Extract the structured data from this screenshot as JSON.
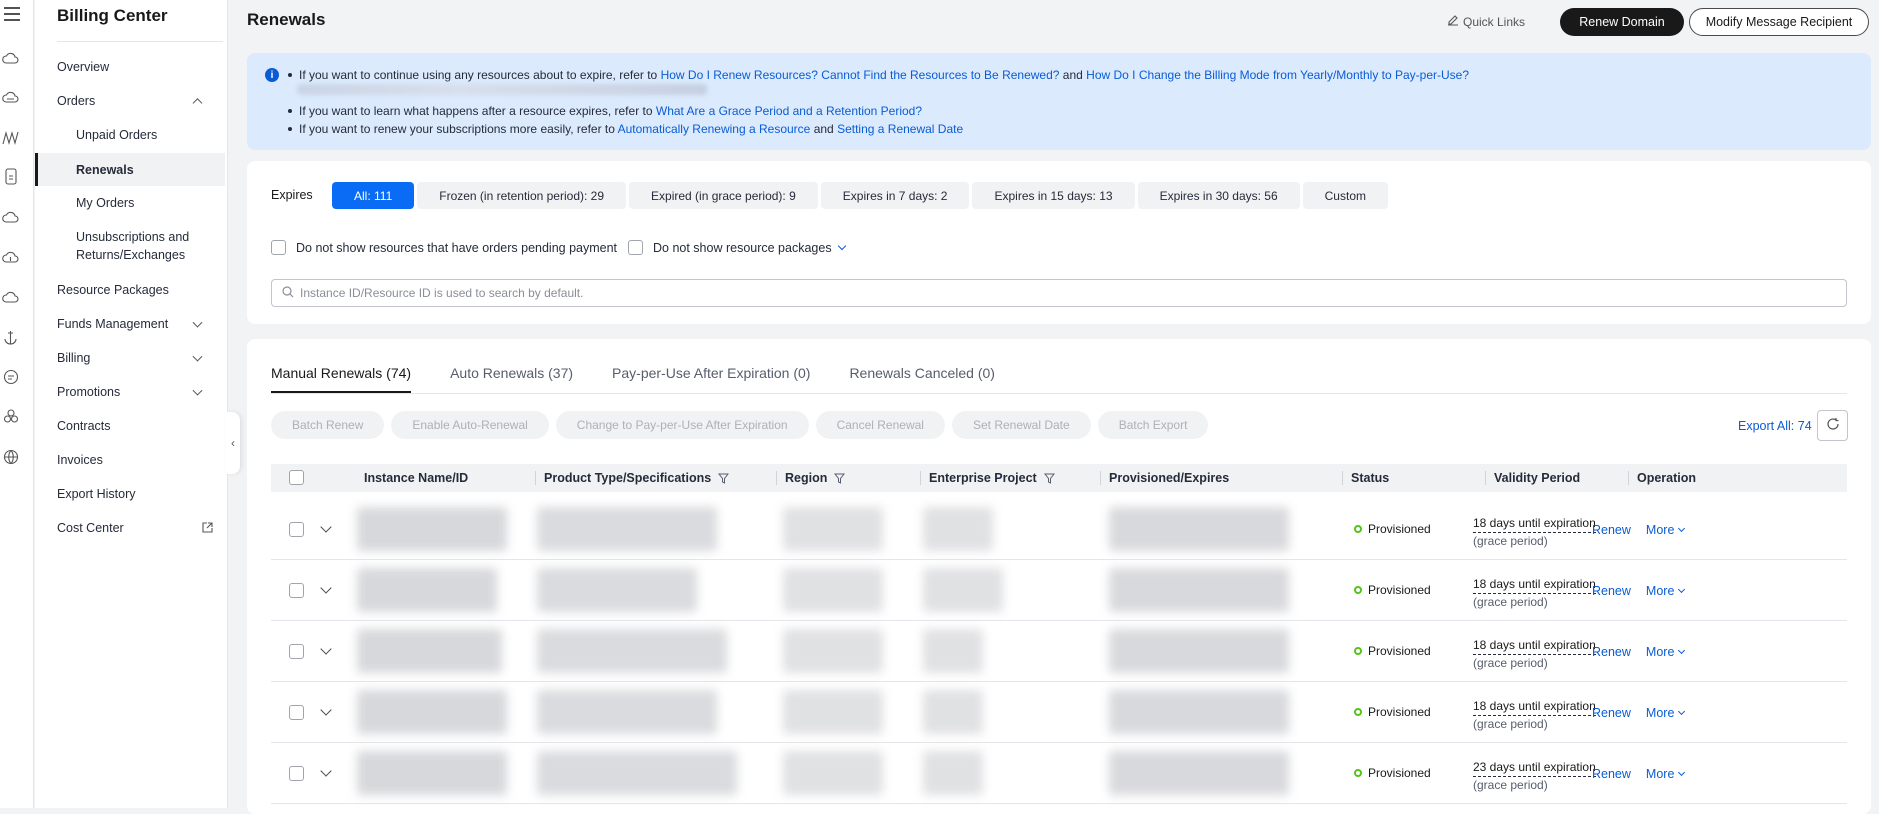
{
  "sidebar": {
    "title": "Billing Center",
    "items": [
      {
        "label": "Overview"
      },
      {
        "label": "Orders"
      },
      {
        "label": "Unpaid Orders"
      },
      {
        "label": "Renewals"
      },
      {
        "label": "My Orders"
      },
      {
        "label": "Unsubscriptions and Returns/Exchanges"
      },
      {
        "label": "Resource Packages"
      },
      {
        "label": "Funds Management"
      },
      {
        "label": "Billing"
      },
      {
        "label": "Promotions"
      },
      {
        "label": "Contracts"
      },
      {
        "label": "Invoices"
      },
      {
        "label": "Export History"
      },
      {
        "label": "Cost Center"
      }
    ]
  },
  "header": {
    "title": "Renewals",
    "quick_links": "Quick Links",
    "renew_domain": "Renew Domain",
    "modify_recipient": "Modify Message Recipient"
  },
  "notice": {
    "line1_text": "If you want to continue using any resources about to expire, refer to",
    "line1_link1": "How Do I Renew Resources? Cannot Find the Resources to Be Renewed?",
    "line1_and": "and",
    "line1_link2": "How Do I Change the Billing Mode from Yearly/Monthly to Pay-per-Use?",
    "line2_text": "If you want to learn what happens after a resource expires, refer to",
    "line2_link": "What Are a Grace Period and a Retention Period?",
    "line3_text": "If you want to renew your subscriptions more easily, refer to",
    "line3_link1": "Automatically Renewing a Resource",
    "line3_and": "and",
    "line3_link2": "Setting a Renewal Date"
  },
  "filters": {
    "expires_label": "Expires",
    "chips": [
      "All: 111",
      "Frozen (in retention period): 29",
      "Expired (in grace period): 9",
      "Expires in 7 days: 2",
      "Expires in 15 days: 13",
      "Expires in 30 days: 56",
      "Custom"
    ],
    "checkbox1": "Do not show resources that have orders pending payment",
    "checkbox2": "Do not show resource packages",
    "search_placeholder": "Instance ID/Resource ID is used to search by default."
  },
  "tabs": [
    "Manual Renewals (74)",
    "Auto Renewals (37)",
    "Pay-per-Use After Expiration (0)",
    "Renewals Canceled (0)"
  ],
  "actions": [
    "Batch Renew",
    "Enable Auto-Renewal",
    "Change to Pay-per-Use After Expiration",
    "Cancel Renewal",
    "Set Renewal Date",
    "Batch Export"
  ],
  "export_all": "Export All: 74",
  "table": {
    "columns": [
      "Instance Name/ID",
      "Product Type/Specifications",
      "Region",
      "Enterprise Project",
      "Provisioned/Expires",
      "Status",
      "Validity Period",
      "Operation"
    ],
    "rows": [
      {
        "status": "Provisioned",
        "validity": "18 days until expiration",
        "note": "(grace period)",
        "renew": "Renew",
        "more": "More"
      },
      {
        "status": "Provisioned",
        "validity": "18 days until expiration",
        "note": "(grace period)",
        "renew": "Renew",
        "more": "More"
      },
      {
        "status": "Provisioned",
        "validity": "18 days until expiration",
        "note": "(grace period)",
        "renew": "Renew",
        "more": "More"
      },
      {
        "status": "Provisioned",
        "validity": "18 days until expiration",
        "note": "(grace period)",
        "renew": "Renew",
        "more": "More"
      },
      {
        "status": "Provisioned",
        "validity": "23 days until expiration",
        "note": "(grace period)",
        "renew": "Renew",
        "more": "More"
      }
    ]
  },
  "colors": {
    "primary": "#0a6cf5",
    "link": "#0a5cd5",
    "notice_bg": "#dbeafd",
    "status_ok": "#52c41a",
    "dark": "#191919"
  }
}
